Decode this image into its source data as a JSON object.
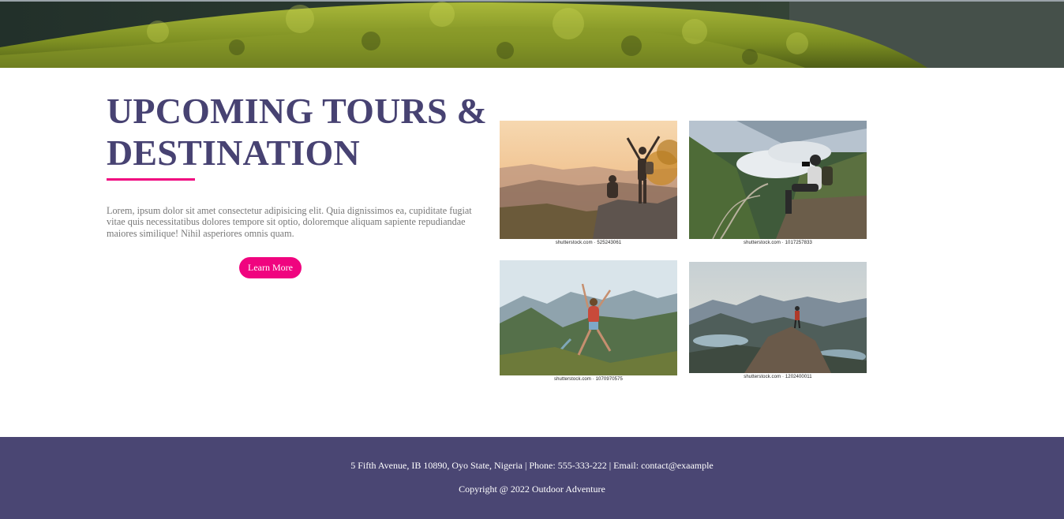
{
  "hero": {
    "image": "mountain-grass-landscape"
  },
  "main": {
    "heading_line1": "UPCOMING TOURS &",
    "heading_line2": "DESTINATION",
    "description": "Lorem, ipsum dolor sit amet consectetur adipisicing elit. Quia dignissimos ea, cupiditate fugiat vitae quis necessitatibus dolores tempore sit optio, doloremque aliquam sapiente repudiandae maiores similique! Nihil asperiores omnis quam.",
    "button_label": "Learn More",
    "accent_color": "#f0047f",
    "heading_color": "#474272"
  },
  "gallery": [
    {
      "image": "hikers-sunset-summit",
      "caption": "shutterstock.com · 525243061"
    },
    {
      "image": "photographer-valley-clouds",
      "caption": "shutterstock.com · 1017257833"
    },
    {
      "image": "woman-jumping-mountain-valley",
      "caption": "shutterstock.com · 1070970575"
    },
    {
      "image": "hiker-on-rock-lake-view",
      "caption": "shutterstock.com · 1202400011"
    }
  ],
  "footer": {
    "contact": "5 Fifth Avenue, IB 10890, Oyo State, Nigeria | Phone: 555-333-222 | Email: contact@exaample",
    "copyright": "Copyright @ 2022 Outdoor Adventure",
    "background_color": "#4a4673"
  }
}
